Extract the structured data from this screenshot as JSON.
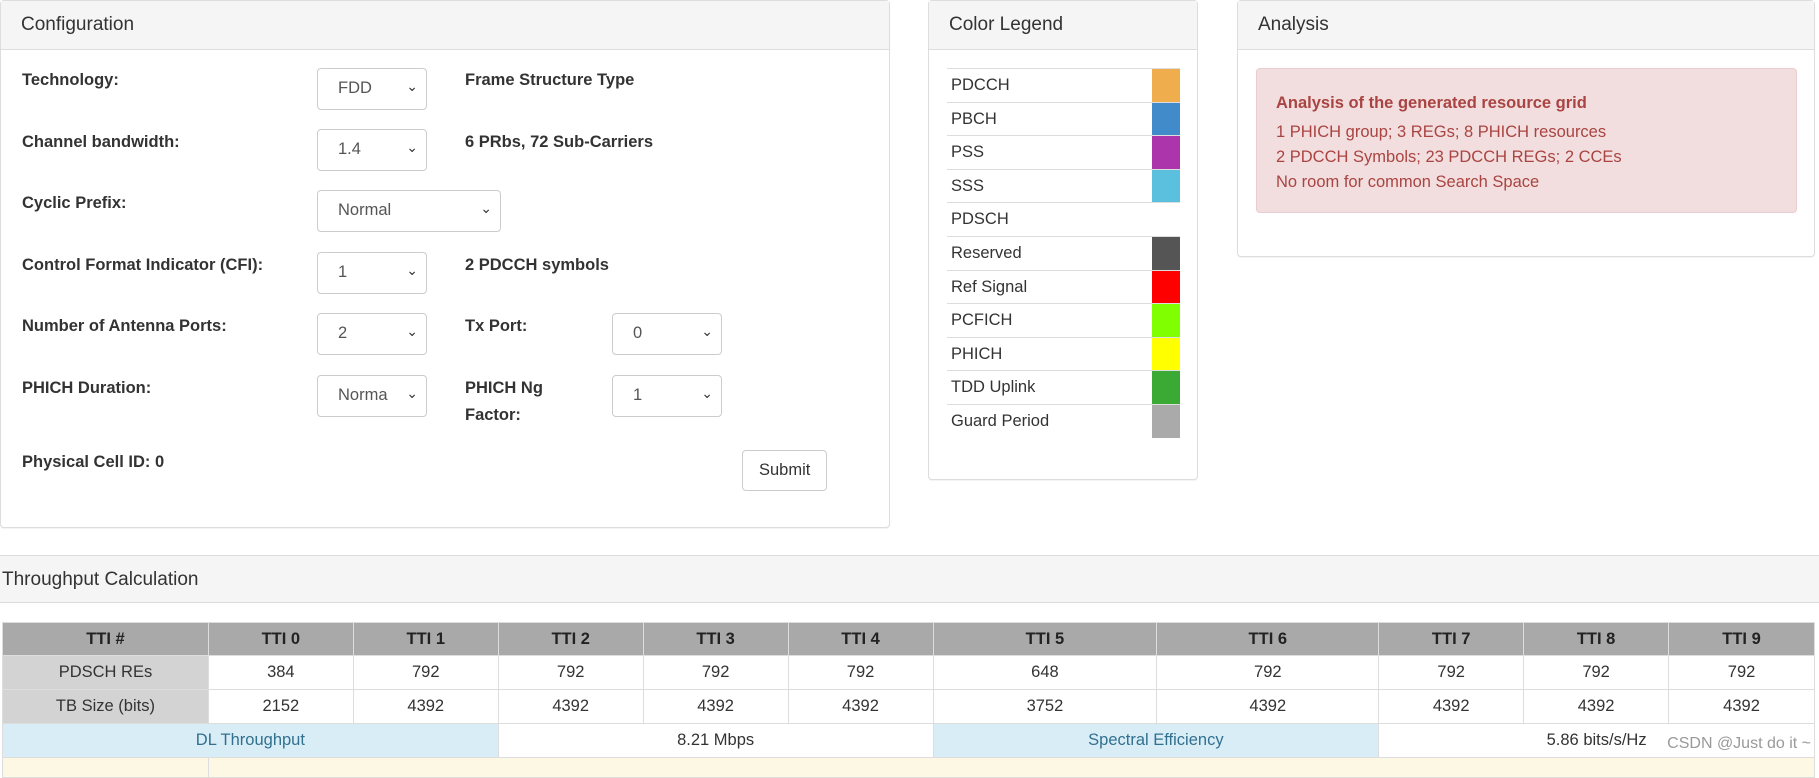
{
  "configuration": {
    "title": "Configuration",
    "technology": {
      "label": "Technology:",
      "value": "FDD",
      "info": "Frame Structure Type"
    },
    "bandwidth": {
      "label": "Channel bandwidth:",
      "value": "1.4",
      "info": "6 PRbs, 72 Sub-Carriers"
    },
    "cyclic_prefix": {
      "label": "Cyclic Prefix:",
      "value": "Normal"
    },
    "cfi": {
      "label": "Control Format Indicator (CFI):",
      "value": "1",
      "info": "2 PDCCH symbols"
    },
    "antenna_ports": {
      "label": "Number of Antenna Ports:",
      "value": "2"
    },
    "tx_port": {
      "label": "Tx Port:",
      "value": "0"
    },
    "phich_duration": {
      "label": "PHICH Duration:",
      "value": "Norma"
    },
    "phich_ng": {
      "label_line1": "PHICH Ng",
      "label_line2": "Factor:",
      "value": "1"
    },
    "cell_id": {
      "label": "Physical Cell ID: 0"
    },
    "submit_label": "Submit"
  },
  "legend": {
    "title": "Color Legend",
    "items": [
      {
        "label": "PDCCH",
        "color": "#f0ad4e"
      },
      {
        "label": "PBCH",
        "color": "#428bca"
      },
      {
        "label": "PSS",
        "color": "#ac35ac"
      },
      {
        "label": "SSS",
        "color": "#5bc0de"
      },
      {
        "label": "PDSCH",
        "color": ""
      },
      {
        "label": "Reserved",
        "color": "#555555"
      },
      {
        "label": "Ref Signal",
        "color": "#ff0000"
      },
      {
        "label": "PCFICH",
        "color": "#7fff00"
      },
      {
        "label": "PHICH",
        "color": "#ffff00"
      },
      {
        "label": "TDD Uplink",
        "color": "#3aaa35"
      },
      {
        "label": "Guard Period",
        "color": "#aaaaaa"
      }
    ]
  },
  "analysis": {
    "title": "Analysis",
    "heading": "Analysis of the generated resource grid",
    "lines": [
      "1 PHICH group; 3 REGs; 8 PHICH resources",
      "2 PDCCH Symbols; 23 PDCCH REGs; 2 CCEs",
      "No room for common Search Space"
    ]
  },
  "throughput": {
    "title": "Throughput Calculation",
    "headers": [
      "TTI #",
      "TTI 0",
      "TTI 1",
      "TTI 2",
      "TTI 3",
      "TTI 4",
      "TTI 5",
      "TTI 6",
      "TTI 7",
      "TTI 8",
      "TTI 9"
    ],
    "rows": [
      {
        "label": "PDSCH REs",
        "values": [
          "384",
          "792",
          "792",
          "792",
          "792",
          "648",
          "792",
          "792",
          "792",
          "792"
        ]
      },
      {
        "label": "TB Size (bits)",
        "values": [
          "2152",
          "4392",
          "4392",
          "4392",
          "4392",
          "3752",
          "4392",
          "4392",
          "4392",
          "4392"
        ]
      }
    ],
    "dl_label": "DL Throughput",
    "dl_value": "8.21 Mbps",
    "se_label": "Spectral Efficiency",
    "se_value": "5.86 bits/s/Hz"
  },
  "watermark": "CSDN @Just do it ~"
}
